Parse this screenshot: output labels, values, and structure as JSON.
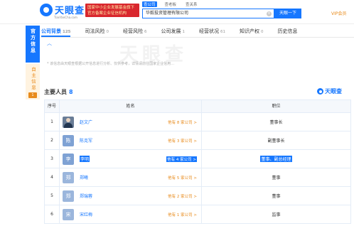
{
  "header": {
    "logo_text": "天眼查",
    "logo_sub": "TianYanCha.com",
    "banner": "国家中小企业发展基金旗下官方备案企业征信机构",
    "search_tabs": [
      "查公司",
      "查老板",
      "查关系"
    ],
    "search_value": "华毅投资管理有限公司",
    "search_button": "天眼一下",
    "vip": "VIP会员"
  },
  "side": {
    "official": "官方信息",
    "self": "自主信息",
    "self_count": "1"
  },
  "nav": {
    "tabs": [
      {
        "label": "公司背景",
        "num": "125"
      },
      {
        "label": "司法风险",
        "num": "0"
      },
      {
        "label": "经营风险",
        "num": "6"
      },
      {
        "label": "公司发展",
        "num": "1"
      },
      {
        "label": "经营状况",
        "num": "61"
      },
      {
        "label": "知识产权",
        "num": "0"
      },
      {
        "label": "历史信息",
        "num": ""
      }
    ]
  },
  "notice": "* 该信息由天眼查根据公开信息进行分析、仅供参考，详情请前往国家企业信用…",
  "watermark": "天眼查",
  "section": {
    "title": "主要人员",
    "count": "8",
    "brand": "天眼查"
  },
  "table": {
    "headers": [
      "序号",
      "姓名",
      "职位"
    ],
    "rows": [
      {
        "idx": "1",
        "avatar": "",
        "name": "赵文广",
        "link": "他有 8 家公司 >",
        "role": "董事长"
      },
      {
        "idx": "2",
        "avatar": "陈",
        "name": "陈克军",
        "link": "他有 3 家公司 >",
        "role": "副董事长"
      },
      {
        "idx": "3",
        "avatar": "李",
        "name": "李明",
        "link": "他有 4 家公司 >",
        "role": "董事、副总经理"
      },
      {
        "idx": "4",
        "avatar": "郑",
        "name": "郑曦",
        "link": "他有 5 家公司 >",
        "role": "董事"
      },
      {
        "idx": "5",
        "avatar": "郑",
        "name": "郑瑞蓉",
        "link": "他有 2 家公司 >",
        "role": "董事"
      },
      {
        "idx": "6",
        "avatar": "宋",
        "name": "宋红梅",
        "link": "他有 1 家公司 >",
        "role": "监事"
      }
    ]
  },
  "colors": {
    "accent": "#1677ff",
    "orange": "#e88a1a",
    "banner_red": "#d9272e",
    "avatar_blue": "#7fa2d4"
  }
}
